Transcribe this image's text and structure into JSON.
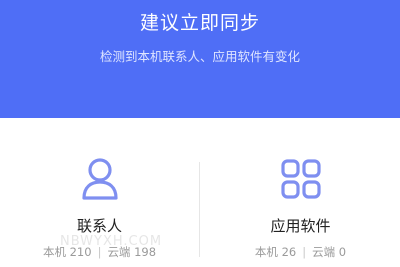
{
  "banner": {
    "title": "建议立即同步",
    "subtitle": "检测到本机联系人、应用软件有变化",
    "color": "#4f6ef6"
  },
  "cards": [
    {
      "icon": "user-icon",
      "label": "联系人",
      "local_label": "本机",
      "local_count": "210",
      "separator": "|",
      "cloud_label": "云端",
      "cloud_count": "198"
    },
    {
      "icon": "apps-grid-icon",
      "label": "应用软件",
      "local_label": "本机",
      "local_count": "26",
      "separator": "|",
      "cloud_label": "云端",
      "cloud_count": "0"
    }
  ],
  "watermark": "NBWYXH.COM"
}
